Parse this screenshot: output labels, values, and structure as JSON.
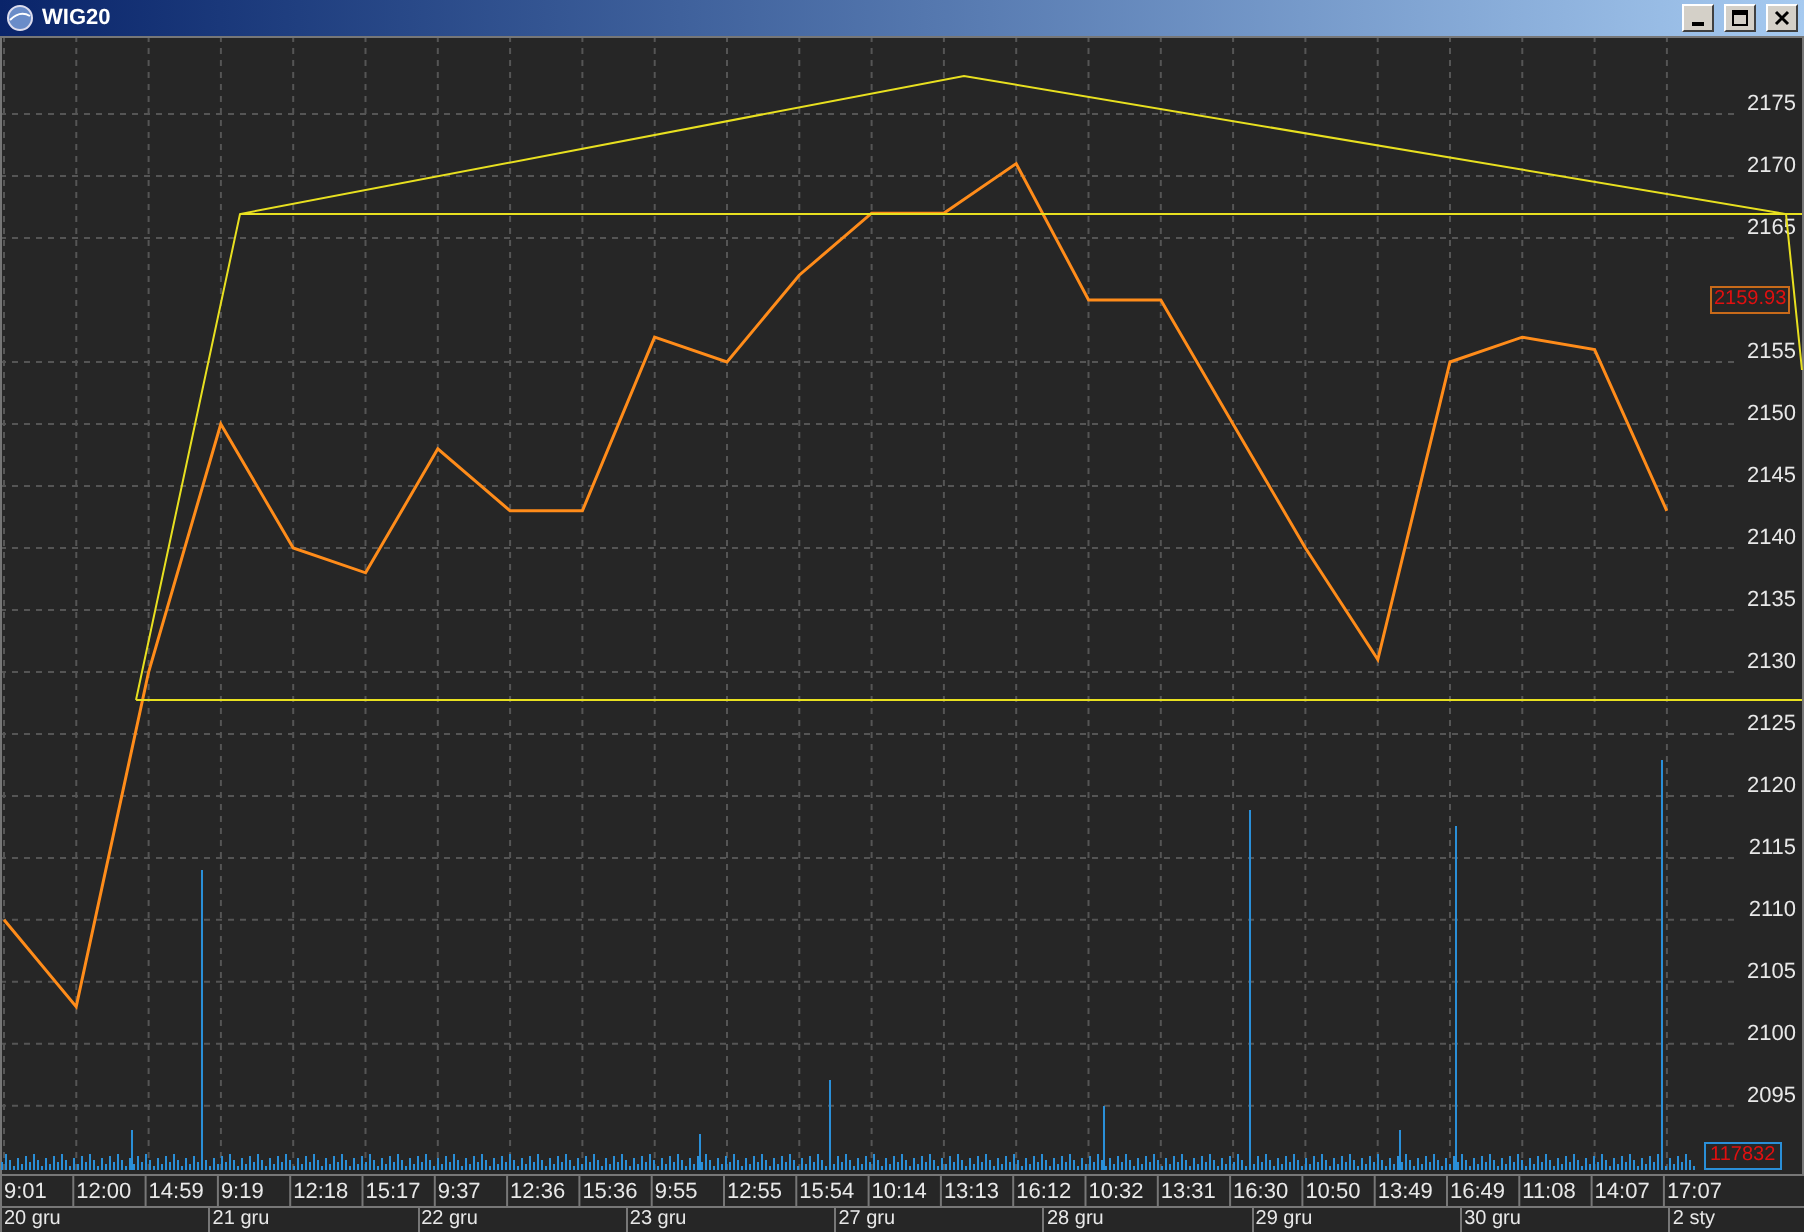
{
  "window": {
    "title": "WIG20"
  },
  "chart": {
    "price_tag": "2159.93",
    "volume_tag": "117832",
    "date_labels": [
      "20 gru",
      "21 gru",
      "22 gru",
      "23 gru",
      "27 gru",
      "28 gru",
      "29 gru",
      "30 gru",
      "2 sty"
    ],
    "chart_data": {
      "type": "line",
      "grid": true,
      "categories": [
        "9:01",
        "12:00",
        "14:59",
        "9:19",
        "12:18",
        "15:17",
        "9:37",
        "12:36",
        "15:36",
        "9:55",
        "12:55",
        "15:54",
        "10:14",
        "13:13",
        "16:12",
        "10:32",
        "13:31",
        "16:30",
        "10:50",
        "13:49",
        "16:49",
        "11:08",
        "14:07",
        "17:07"
      ],
      "series": [
        {
          "color": "#ff8c1a",
          "values": [
            2110,
            2103,
            2130,
            2150,
            2140,
            2138,
            2148,
            2143,
            2143,
            2157,
            2155,
            2162,
            2167,
            2167,
            2171,
            2160,
            2160,
            2150,
            2140,
            2131,
            2155,
            2157,
            2156,
            2143
          ]
        }
      ],
      "ylim": [
        2089.5,
        2181.3
      ],
      "yticks": [
        2095,
        2100,
        2105,
        2110,
        2115,
        2120,
        2125,
        2130,
        2135,
        2140,
        2145,
        2150,
        2155,
        2165,
        2170,
        2175
      ]
    }
  }
}
